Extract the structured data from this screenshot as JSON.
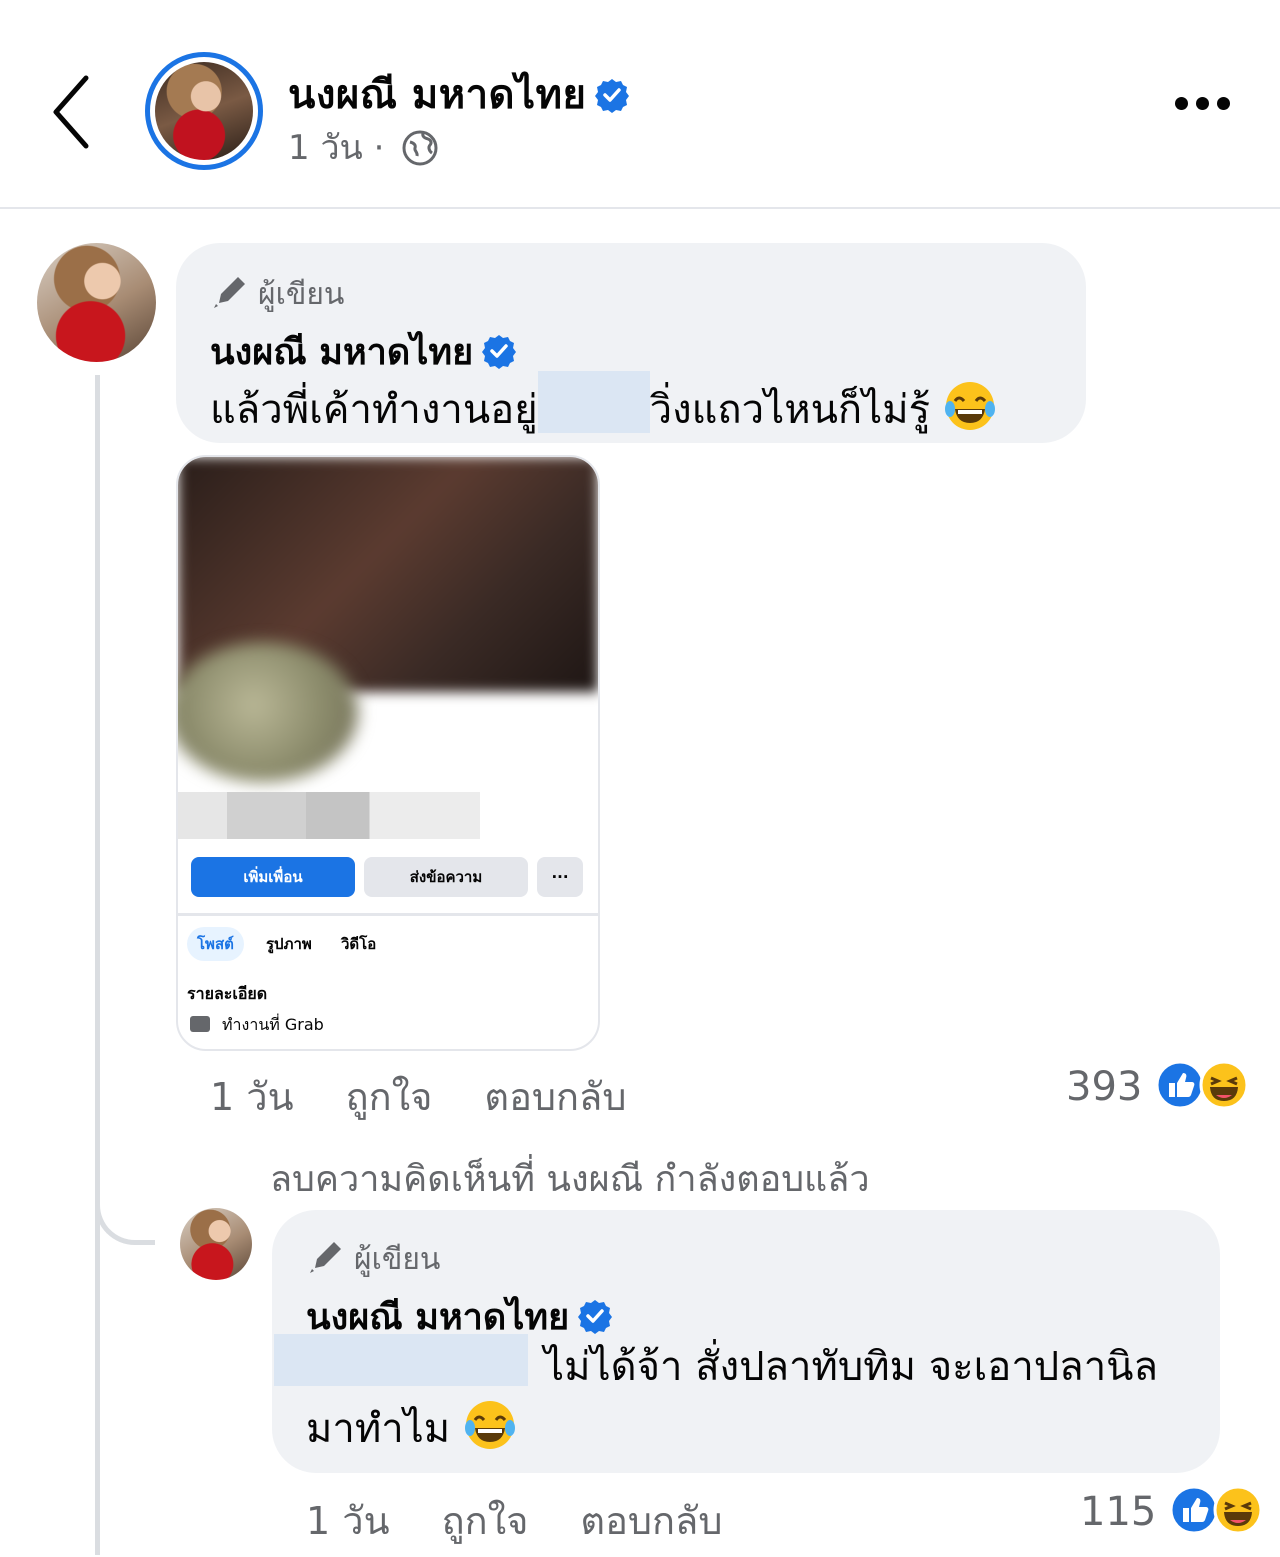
{
  "header": {
    "page_name": "นงผณี มหาดไทย",
    "time": "1 วัน",
    "separator": "·"
  },
  "comment": {
    "author_tag": "ผู้เขียน",
    "name": "นงผณี มหาดไทย",
    "text_before": "แล้วพี่เค้าทำงานอยู่",
    "text_after": "วิ่งแถวไหนก็ไม่รู้",
    "attachment": {
      "add_friend": "เพิ่มเพื่อน",
      "message": "ส่งข้อความ",
      "more": "···",
      "tabs": [
        "โพสต์",
        "รูปภาพ",
        "วิดีโอ"
      ],
      "details_label": "รายละเอียด",
      "work": "ทำงานที่ Grab"
    },
    "time": "1 วัน",
    "like": "ถูกใจ",
    "reply": "ตอบกลับ",
    "reaction_count": "393"
  },
  "deleted_notice": "ลบความคิดเห็นที่ นงผณี กำลังตอบแล้ว",
  "reply": {
    "author_tag": "ผู้เขียน",
    "name": "นงผณี มหาดไทย",
    "text_line1": "ไม่ได้จ้า สั่งปลาทับทิม จะเอาปลานิล",
    "text_line2": "มาทำไม",
    "time": "1 วัน",
    "like": "ถูกใจ",
    "reply": "ตอบกลับ",
    "reaction_count": "115"
  },
  "colors": {
    "accent": "#1b74e4",
    "bubble": "#f0f2f5",
    "secondary_text": "#65676b"
  },
  "icons": [
    "back-chevron-icon",
    "verified-badge-icon",
    "globe-icon",
    "more-dots-icon",
    "pen-icon",
    "laughing-emoji-icon",
    "like-reaction-icon",
    "haha-reaction-icon"
  ]
}
